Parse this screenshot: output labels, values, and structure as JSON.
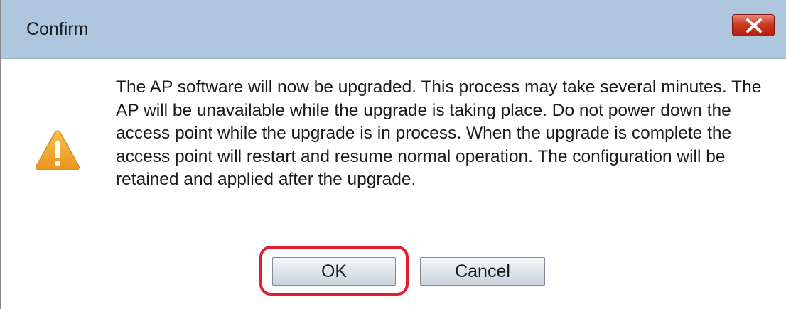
{
  "dialog": {
    "title": "Confirm",
    "message": "The AP software will now be upgraded. This process may take several minutes. The AP will be unavailable while the upgrade is taking place. Do not power down the access point while the upgrade is in process. When the upgrade is complete the access point will restart and resume normal operation. The configuration will be retained and applied after the upgrade.",
    "icon": "warning-icon",
    "close_icon": "close-icon",
    "buttons": {
      "ok_label": "OK",
      "cancel_label": "Cancel"
    }
  },
  "colors": {
    "titlebar": "#aec7df",
    "close_button": "#cf3a22",
    "warning": "#f0a830",
    "highlight": "#e02030"
  }
}
